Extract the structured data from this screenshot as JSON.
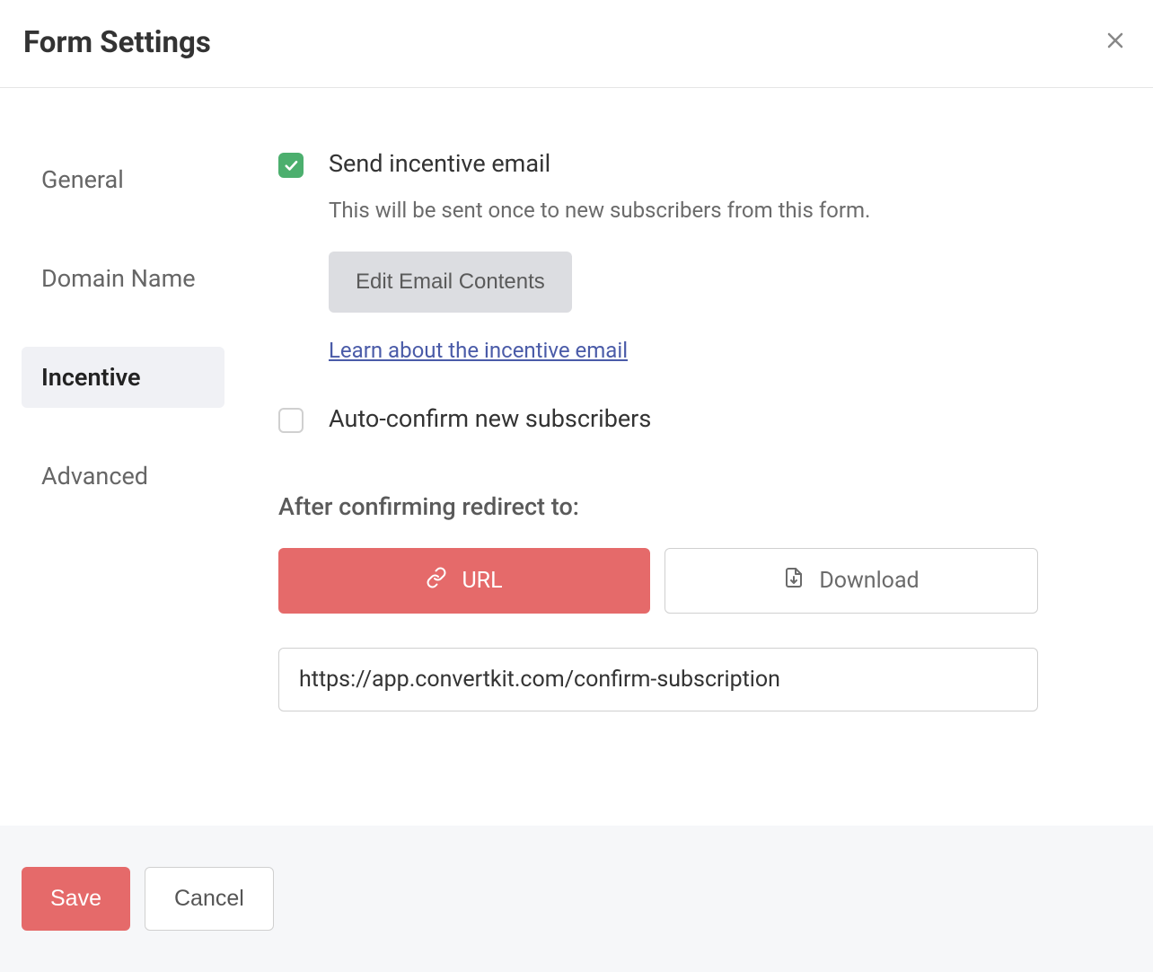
{
  "header": {
    "title": "Form Settings"
  },
  "sidebar": {
    "items": [
      {
        "label": "General",
        "active": false
      },
      {
        "label": "Domain Name",
        "active": false
      },
      {
        "label": "Incentive",
        "active": true
      },
      {
        "label": "Advanced",
        "active": false
      }
    ]
  },
  "main": {
    "incentive": {
      "label": "Send incentive email",
      "checked": true,
      "description": "This will be sent once to new subscribers from this form.",
      "edit_button": "Edit Email Contents",
      "learn_link": "Learn about the incentive email"
    },
    "autoconfirm": {
      "label": "Auto-confirm new subscribers",
      "checked": false
    },
    "redirect": {
      "heading": "After confirming redirect to:",
      "url_button": "URL",
      "download_button": "Download",
      "url_value": "https://app.convertkit.com/confirm-subscription"
    }
  },
  "footer": {
    "save_label": "Save",
    "cancel_label": "Cancel"
  }
}
